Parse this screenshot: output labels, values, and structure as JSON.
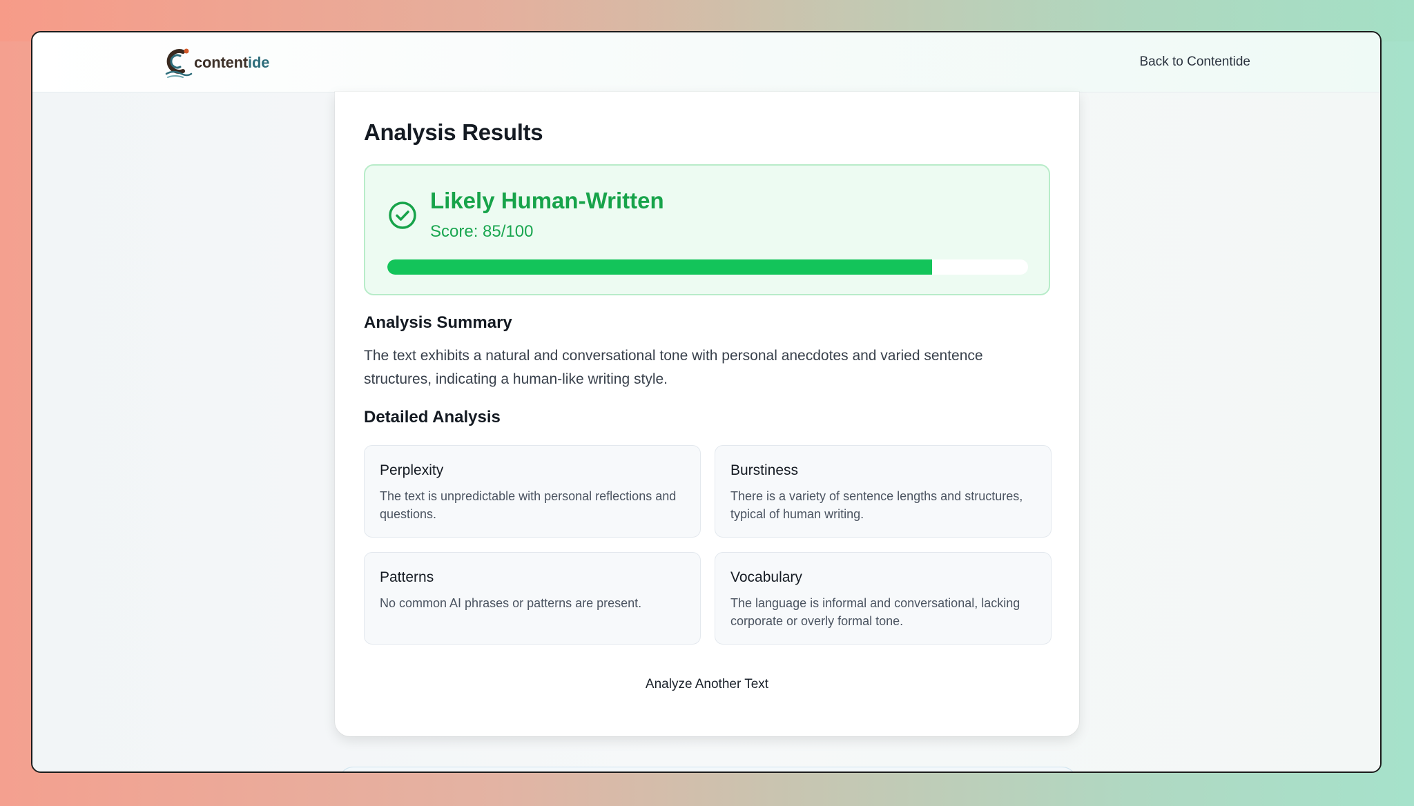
{
  "header": {
    "logo_text_main": "content",
    "logo_text_accent": "ide",
    "back_link": "Back to Contentide"
  },
  "results": {
    "title": "Analysis Results",
    "verdict": "Likely Human-Written",
    "score_text": "Score: 85/100",
    "score": 85,
    "score_max": 100,
    "verdict_color": "#17a34a",
    "bar_color": "#13c45a",
    "verdict_icon": "check-circle-icon"
  },
  "summary": {
    "heading": "Analysis Summary",
    "text": "The text exhibits a natural and conversational tone with personal anecdotes and varied sentence structures, indicating a human-like writing style."
  },
  "detailed": {
    "heading": "Detailed Analysis",
    "items": [
      {
        "title": "Perplexity",
        "description": "The text is unpredictable with personal reflections and questions."
      },
      {
        "title": "Burstiness",
        "description": "There is a variety of sentence lengths and structures, typical of human writing."
      },
      {
        "title": "Patterns",
        "description": "No common AI phrases or patterns are present."
      },
      {
        "title": "Vocabulary",
        "description": "The language is informal and conversational, lacking corporate or overly formal tone."
      }
    ]
  },
  "actions": {
    "analyze_another": "Analyze Another Text"
  }
}
